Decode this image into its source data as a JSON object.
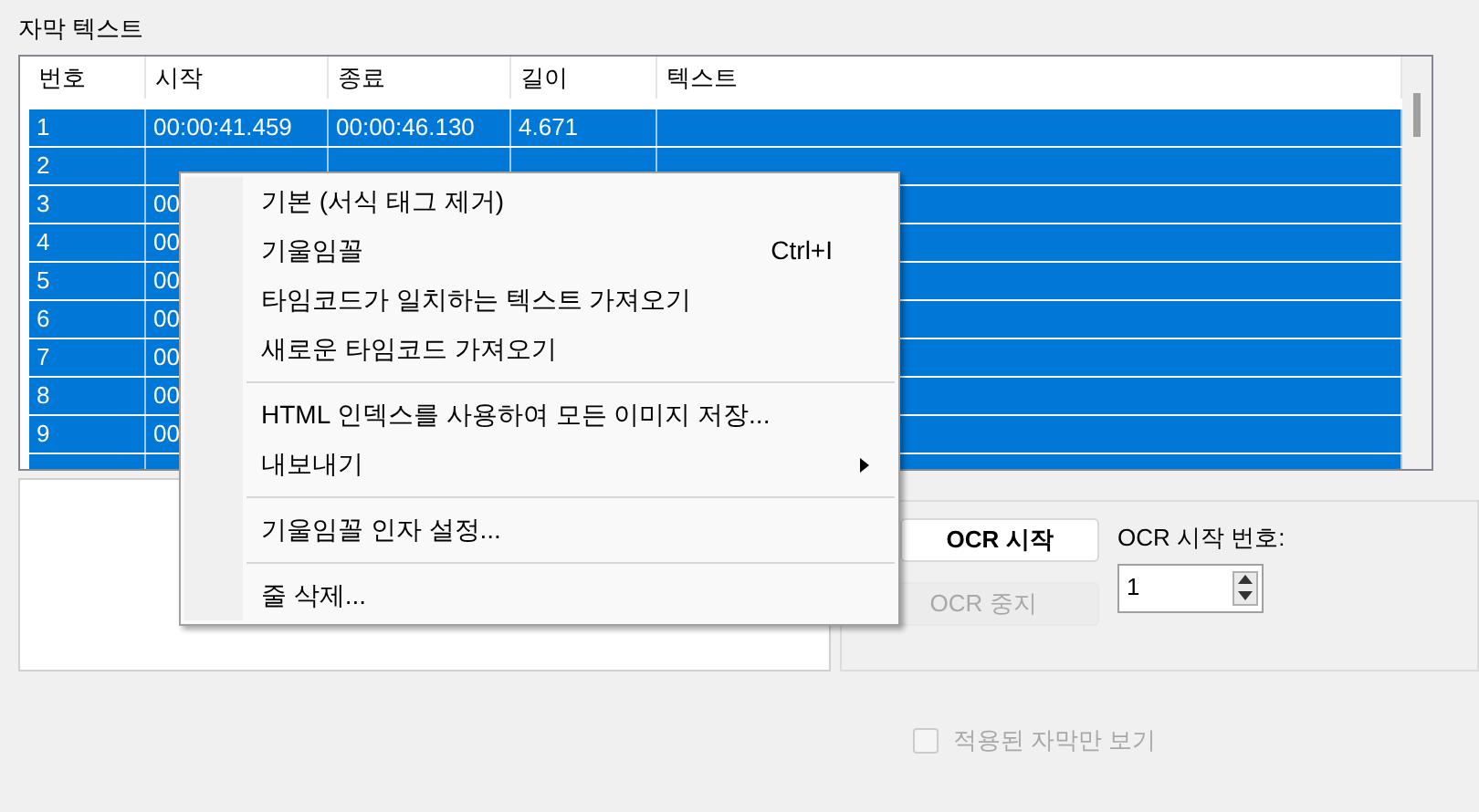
{
  "group_title": "자막 텍스트",
  "table": {
    "columns": [
      "번호",
      "시작",
      "종료",
      "길이",
      "텍스트"
    ],
    "rows": [
      {
        "cells": [
          "1",
          "00:00:41.459",
          "00:00:46.130",
          "4.671",
          ""
        ],
        "selected": true
      },
      {
        "cells": [
          "2"
        ],
        "selected": true
      },
      {
        "cells": [
          "3",
          "00"
        ],
        "selected": true
      },
      {
        "cells": [
          "4",
          "00"
        ],
        "selected": true
      },
      {
        "cells": [
          "5",
          "00"
        ],
        "selected": true
      },
      {
        "cells": [
          "6",
          "00"
        ],
        "selected": true
      },
      {
        "cells": [
          "7",
          "00"
        ],
        "selected": true
      },
      {
        "cells": [
          "8",
          "00"
        ],
        "selected": true
      },
      {
        "cells": [
          "9",
          "00"
        ],
        "selected": true
      },
      {
        "cells": [],
        "selected": true
      }
    ]
  },
  "context_menu": [
    {
      "kind": "item",
      "label": "기본 (서식 태그 제거)"
    },
    {
      "kind": "item",
      "label": "기울임꼴",
      "shortcut": "Ctrl+I"
    },
    {
      "kind": "item",
      "label": "타임코드가 일치하는 텍스트 가져오기"
    },
    {
      "kind": "item",
      "label": "새로운 타임코드 가져오기"
    },
    {
      "kind": "separator"
    },
    {
      "kind": "item",
      "label": "HTML 인덱스를 사용하여 모든 이미지 저장..."
    },
    {
      "kind": "submenu",
      "label": "내보내기"
    },
    {
      "kind": "separator"
    },
    {
      "kind": "item",
      "label": "기울임꼴 인자 설정..."
    },
    {
      "kind": "separator"
    },
    {
      "kind": "item",
      "label": "줄 삭제..."
    }
  ],
  "ocr": {
    "start_button": {
      "label": "OCR 시작",
      "disabled": false
    },
    "stop_button": {
      "label": "OCR 중지",
      "disabled": true
    },
    "start_number_label": "OCR 시작 번호:",
    "start_number": "1"
  },
  "show_only_applied": {
    "label": "적용된 자막만 보기",
    "checked": false,
    "disabled": true
  }
}
